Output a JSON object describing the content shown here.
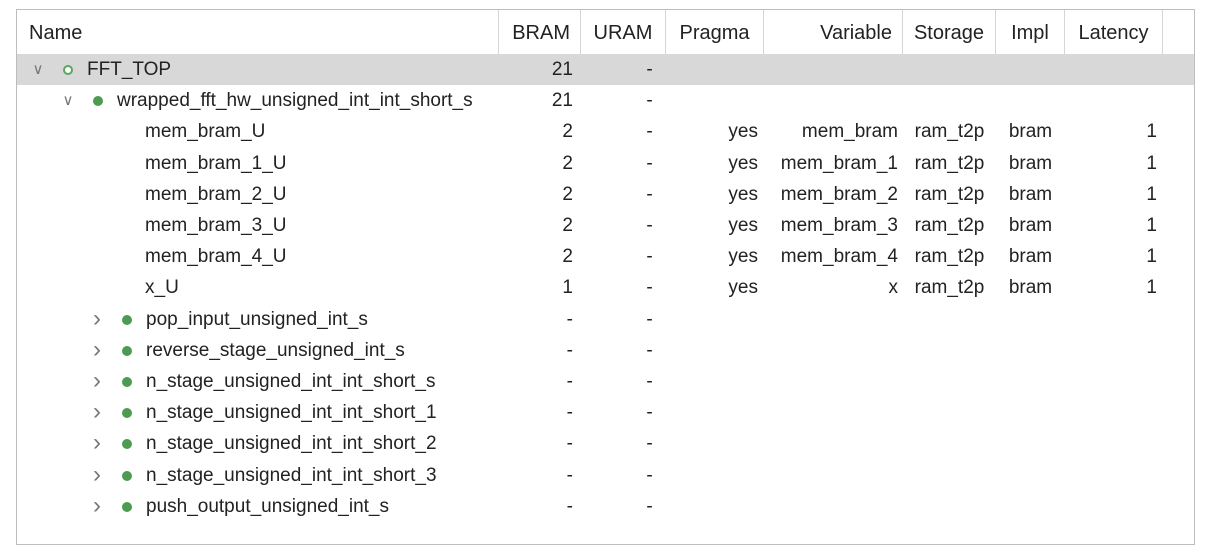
{
  "columns": {
    "name": "Name",
    "bram": "BRAM",
    "uram": "URAM",
    "pragma": "Pragma",
    "variable": "Variable",
    "storage": "Storage",
    "impl": "Impl",
    "latency": "Latency"
  },
  "rows": [
    {
      "level": 0,
      "expander": "expanded",
      "dot": "hollow",
      "name": "FFT_TOP",
      "bram": "21",
      "uram": "-",
      "pragma": "",
      "variable": "",
      "storage": "",
      "impl": "",
      "latency": "",
      "selected": true
    },
    {
      "level": 1,
      "expander": "expanded",
      "dot": "solid",
      "name": "wrapped_fft_hw_unsigned_int_int_short_s",
      "bram": "21",
      "uram": "-",
      "pragma": "",
      "variable": "",
      "storage": "",
      "impl": "",
      "latency": ""
    },
    {
      "level": 2,
      "expander": "none",
      "dot": "none",
      "name": "mem_bram_U",
      "bram": "2",
      "uram": "-",
      "pragma": "yes",
      "variable": "mem_bram",
      "storage": "ram_t2p",
      "impl": "bram",
      "latency": "1"
    },
    {
      "level": 2,
      "expander": "none",
      "dot": "none",
      "name": "mem_bram_1_U",
      "bram": "2",
      "uram": "-",
      "pragma": "yes",
      "variable": "mem_bram_1",
      "storage": "ram_t2p",
      "impl": "bram",
      "latency": "1"
    },
    {
      "level": 2,
      "expander": "none",
      "dot": "none",
      "name": "mem_bram_2_U",
      "bram": "2",
      "uram": "-",
      "pragma": "yes",
      "variable": "mem_bram_2",
      "storage": "ram_t2p",
      "impl": "bram",
      "latency": "1"
    },
    {
      "level": 2,
      "expander": "none",
      "dot": "none",
      "name": "mem_bram_3_U",
      "bram": "2",
      "uram": "-",
      "pragma": "yes",
      "variable": "mem_bram_3",
      "storage": "ram_t2p",
      "impl": "bram",
      "latency": "1"
    },
    {
      "level": 2,
      "expander": "none",
      "dot": "none",
      "name": "mem_bram_4_U",
      "bram": "2",
      "uram": "-",
      "pragma": "yes",
      "variable": "mem_bram_4",
      "storage": "ram_t2p",
      "impl": "bram",
      "latency": "1"
    },
    {
      "level": 2,
      "expander": "none",
      "dot": "none",
      "name": "x_U",
      "bram": "1",
      "uram": "-",
      "pragma": "yes",
      "variable": "x",
      "storage": "ram_t2p",
      "impl": "bram",
      "latency": "1"
    },
    {
      "level": 2,
      "expander": "collapsed",
      "dot": "solid",
      "name": "pop_input_unsigned_int_s",
      "bram": "-",
      "uram": "-",
      "pragma": "",
      "variable": "",
      "storage": "",
      "impl": "",
      "latency": ""
    },
    {
      "level": 2,
      "expander": "collapsed",
      "dot": "solid",
      "name": "reverse_stage_unsigned_int_s",
      "bram": "-",
      "uram": "-",
      "pragma": "",
      "variable": "",
      "storage": "",
      "impl": "",
      "latency": ""
    },
    {
      "level": 2,
      "expander": "collapsed",
      "dot": "solid",
      "name": "n_stage_unsigned_int_int_short_s",
      "bram": "-",
      "uram": "-",
      "pragma": "",
      "variable": "",
      "storage": "",
      "impl": "",
      "latency": ""
    },
    {
      "level": 2,
      "expander": "collapsed",
      "dot": "solid",
      "name": "n_stage_unsigned_int_int_short_1",
      "bram": "-",
      "uram": "-",
      "pragma": "",
      "variable": "",
      "storage": "",
      "impl": "",
      "latency": ""
    },
    {
      "level": 2,
      "expander": "collapsed",
      "dot": "solid",
      "name": "n_stage_unsigned_int_int_short_2",
      "bram": "-",
      "uram": "-",
      "pragma": "",
      "variable": "",
      "storage": "",
      "impl": "",
      "latency": ""
    },
    {
      "level": 2,
      "expander": "collapsed",
      "dot": "solid",
      "name": "n_stage_unsigned_int_int_short_3",
      "bram": "-",
      "uram": "-",
      "pragma": "",
      "variable": "",
      "storage": "",
      "impl": "",
      "latency": ""
    },
    {
      "level": 2,
      "expander": "collapsed",
      "dot": "solid",
      "name": "push_output_unsigned_int_s",
      "bram": "-",
      "uram": "-",
      "pragma": "",
      "variable": "",
      "storage": "",
      "impl": "",
      "latency": ""
    }
  ],
  "colors": {
    "selected_row": "#d8d8d8",
    "status_dot": "#4c9b50",
    "border": "#bdbdbd"
  },
  "icons": {
    "expanded": "chevron-down-icon",
    "collapsed": "chevron-right-icon",
    "status": "status-dot-icon"
  }
}
